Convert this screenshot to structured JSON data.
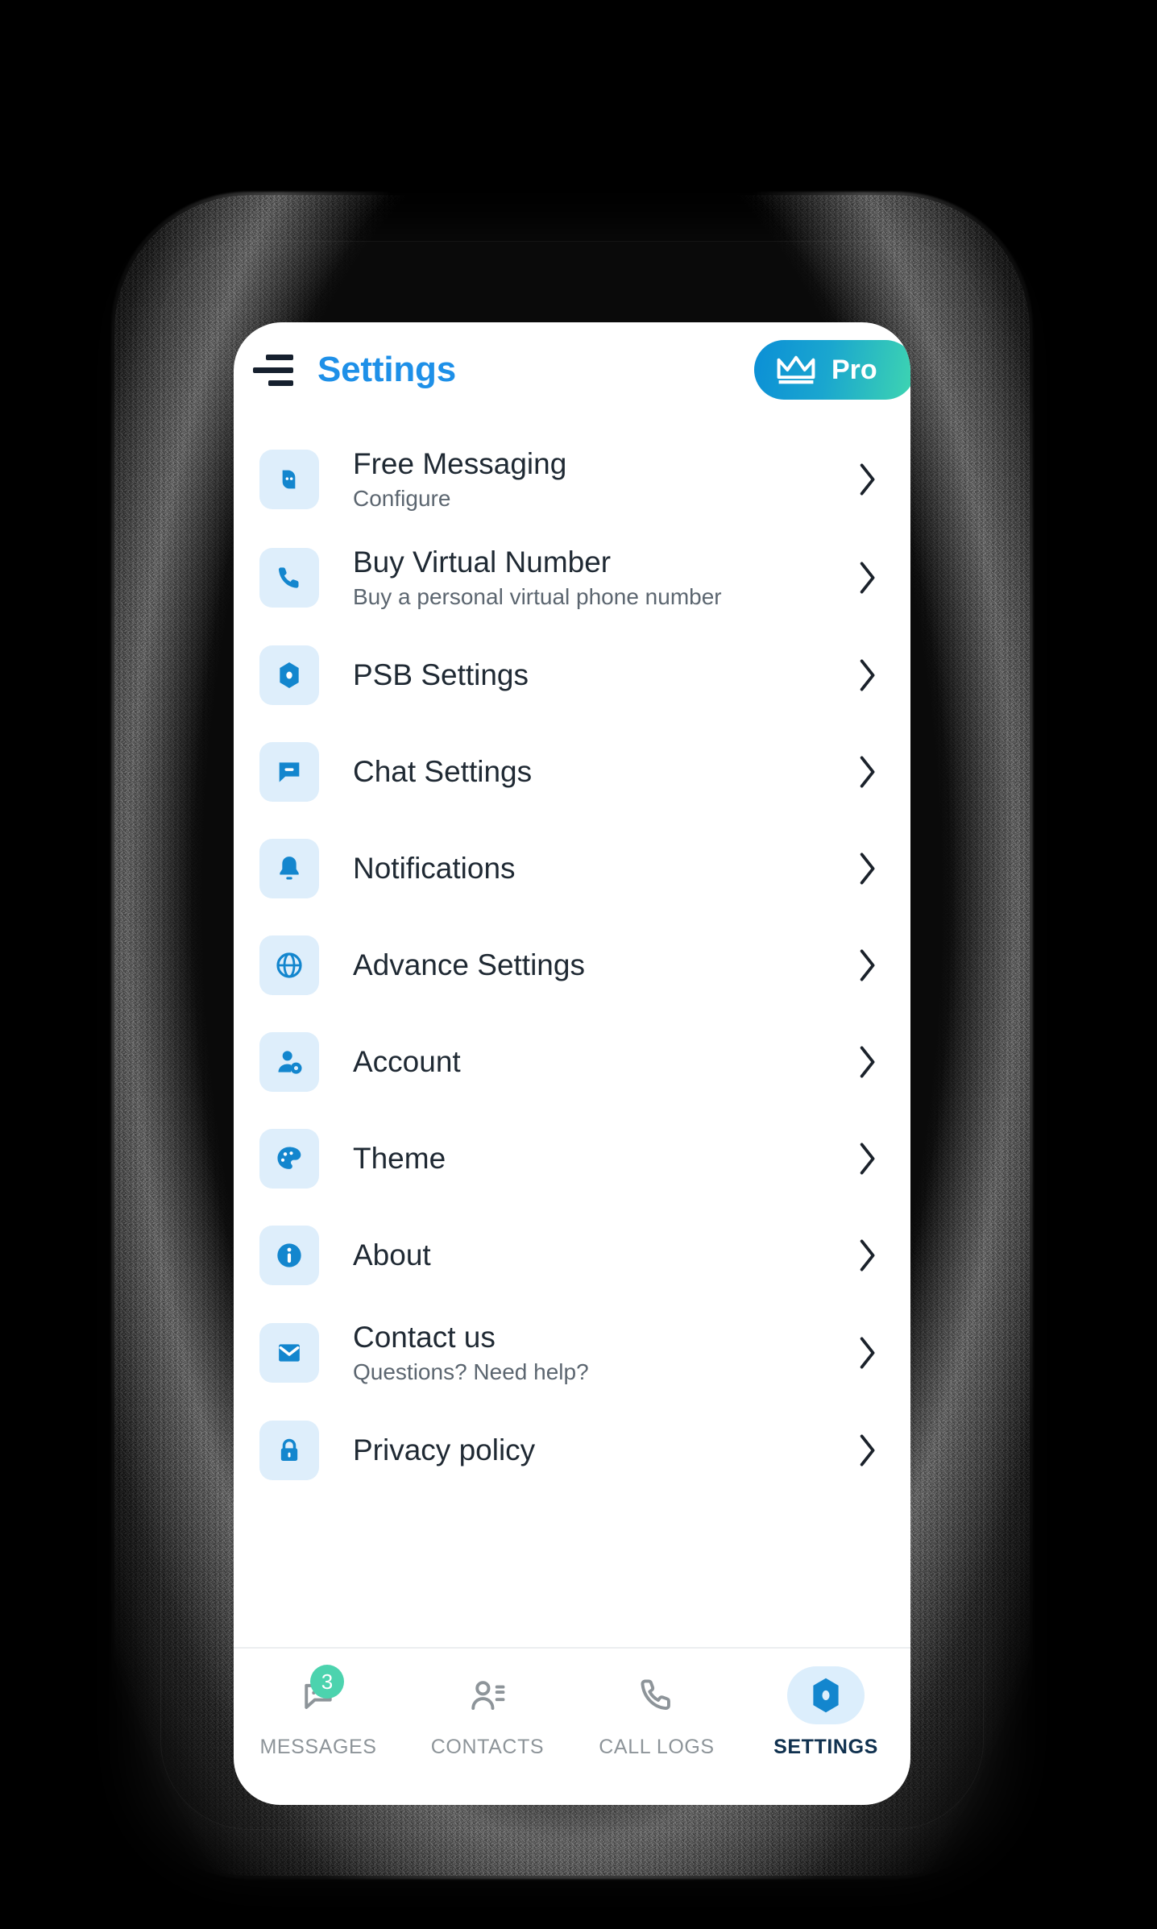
{
  "app": {
    "title": "Settings",
    "menu_icon": "hamburger-icon",
    "pro_button": {
      "label": "Pro",
      "icon": "crown-icon",
      "gradient_from": "#0b8fd6",
      "gradient_to": "#3fd6b0"
    },
    "accent_color": "#1E90E8",
    "icon_tile_color": "#DEEEFB"
  },
  "settings": {
    "items": [
      {
        "title": "Free Messaging",
        "subtitle": "Configure",
        "icon": "chat-bubble-icon",
        "chevron": "chevron-right-icon"
      },
      {
        "title": "Buy Virtual Number",
        "subtitle": "Buy a personal virtual phone number",
        "icon": "phone-icon",
        "chevron": "chevron-right-icon"
      },
      {
        "title": "PSB Settings",
        "subtitle": "",
        "icon": "hexagon-icon",
        "chevron": "chevron-right-icon"
      },
      {
        "title": "Chat Settings",
        "subtitle": "",
        "icon": "chat-settings-icon",
        "chevron": "chevron-right-icon"
      },
      {
        "title": "Notifications",
        "subtitle": "",
        "icon": "bell-icon",
        "chevron": "chevron-right-icon"
      },
      {
        "title": "Advance Settings",
        "subtitle": "",
        "icon": "globe-icon",
        "chevron": "chevron-right-icon"
      },
      {
        "title": "Account",
        "subtitle": "",
        "icon": "account-gear-icon",
        "chevron": "chevron-right-icon"
      },
      {
        "title": "Theme",
        "subtitle": "",
        "icon": "palette-icon",
        "chevron": "chevron-right-icon"
      },
      {
        "title": "About",
        "subtitle": "",
        "icon": "info-icon",
        "chevron": "chevron-right-icon"
      },
      {
        "title": "Contact us",
        "subtitle": "Questions? Need help?",
        "icon": "envelope-icon",
        "chevron": "chevron-right-icon"
      },
      {
        "title": "Privacy policy",
        "subtitle": "",
        "icon": "lock-icon",
        "chevron": "chevron-right-icon"
      }
    ]
  },
  "bottom_nav": {
    "active": "SETTINGS",
    "items": [
      {
        "label": "MESSAGES",
        "icon": "message-icon",
        "badge": "3",
        "badge_color": "#4CD3AE",
        "active": false
      },
      {
        "label": "CONTACTS",
        "icon": "contacts-icon",
        "badge": "",
        "badge_color": "",
        "active": false
      },
      {
        "label": "CALL LOGS",
        "icon": "call-log-icon",
        "badge": "",
        "badge_color": "",
        "active": false
      },
      {
        "label": "SETTINGS",
        "icon": "hexagon-icon",
        "badge": "",
        "badge_color": "",
        "active": true
      }
    ]
  }
}
